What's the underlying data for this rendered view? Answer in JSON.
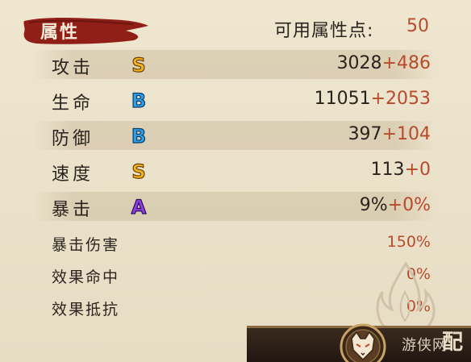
{
  "header": {
    "title": "属性",
    "points_label": "可用属性点:",
    "points_value": "50"
  },
  "stats": [
    {
      "label": "攻击",
      "grade": "S",
      "grade_color": "#f2b21f",
      "base": "3028",
      "bonus": "+486"
    },
    {
      "label": "生命",
      "grade": "B",
      "grade_color": "#2f9ee6",
      "base": "11051",
      "bonus": "+2053"
    },
    {
      "label": "防御",
      "grade": "B",
      "grade_color": "#2f9ee6",
      "base": "397",
      "bonus": "+104"
    },
    {
      "label": "速度",
      "grade": "S",
      "grade_color": "#f2b21f",
      "base": "113",
      "bonus": "+0"
    },
    {
      "label": "暴击",
      "grade": "A",
      "grade_color": "#8e3fe0",
      "base": "9%",
      "bonus": "+0%"
    }
  ],
  "sub_stats": [
    {
      "label": "暴击伤害",
      "value": "150%"
    },
    {
      "label": "效果命中",
      "value": "0%"
    },
    {
      "label": "效果抵抗",
      "value": "0%"
    }
  ],
  "footer": {
    "watermark": "游侠网",
    "corner_glyph": "配"
  },
  "colors": {
    "accent_red": "#b84b2b",
    "text_dark": "#2a231d",
    "header_brush": "#8f1f17"
  },
  "icons": {
    "mask": "fox-mask-icon",
    "flame": "flame-decoration-icon"
  }
}
